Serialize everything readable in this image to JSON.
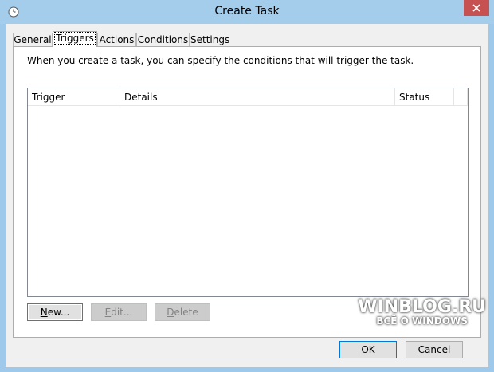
{
  "window": {
    "title": "Create Task",
    "close_glyph": "✕"
  },
  "tabs": [
    {
      "label": "General",
      "active": false
    },
    {
      "label": "Triggers",
      "active": true
    },
    {
      "label": "Actions",
      "active": false
    },
    {
      "label": "Conditions",
      "active": false
    },
    {
      "label": "Settings",
      "active": false
    }
  ],
  "triggers_panel": {
    "intro_text": "When you create a task, you can specify the conditions that will trigger the task.",
    "columns": [
      "Trigger",
      "Details",
      "Status"
    ],
    "rows": []
  },
  "buttons": {
    "new": {
      "pre": "",
      "mnemonic": "N",
      "post": "ew..."
    },
    "edit": {
      "pre": "",
      "mnemonic": "E",
      "post": "dit..."
    },
    "delete": {
      "pre": "",
      "mnemonic": "D",
      "post": "elete"
    }
  },
  "dialog_buttons": {
    "ok": "OK",
    "cancel": "Cancel"
  },
  "watermark": {
    "line1": "WINBLOG.RU",
    "line2": "ВСЁ О WINDOWS"
  },
  "colors": {
    "titlebar": "#a4cdec",
    "close_button": "#c75050",
    "client_bg": "#f0f0f0"
  },
  "icons": {
    "app_icon": "clock-icon",
    "close": "close-icon"
  }
}
